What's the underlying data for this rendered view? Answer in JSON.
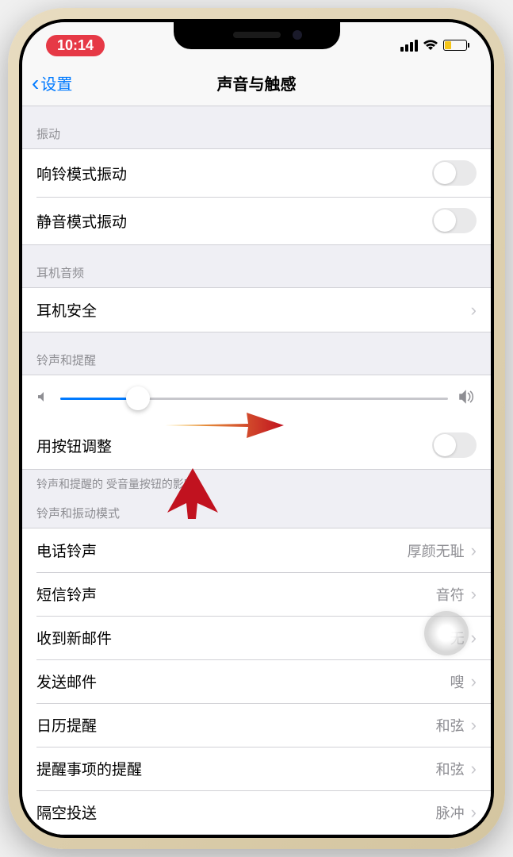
{
  "status": {
    "time": "10:14"
  },
  "nav": {
    "back": "设置",
    "title": "声音与触感"
  },
  "sections": {
    "vibration": {
      "header": "振动",
      "ring": "响铃模式振动",
      "silent": "静音模式振动"
    },
    "headphone": {
      "header": "耳机音频",
      "safety": "耳机安全"
    },
    "ringer": {
      "header": "铃声和提醒",
      "button_adjust": "用按钮调整",
      "footer": "铃声和提醒的            受音量按钮的影响。",
      "slider_percent": 20
    },
    "sounds": {
      "header": "铃声和振动模式",
      "items": [
        {
          "label": "电话铃声",
          "value": "厚颜无耻"
        },
        {
          "label": "短信铃声",
          "value": "音符"
        },
        {
          "label": "收到新邮件",
          "value": "无"
        },
        {
          "label": "发送邮件",
          "value": "嗖"
        },
        {
          "label": "日历提醒",
          "value": "和弦"
        },
        {
          "label": "提醒事项的提醒",
          "value": "和弦"
        },
        {
          "label": "隔空投送",
          "value": "脉冲"
        }
      ]
    }
  }
}
